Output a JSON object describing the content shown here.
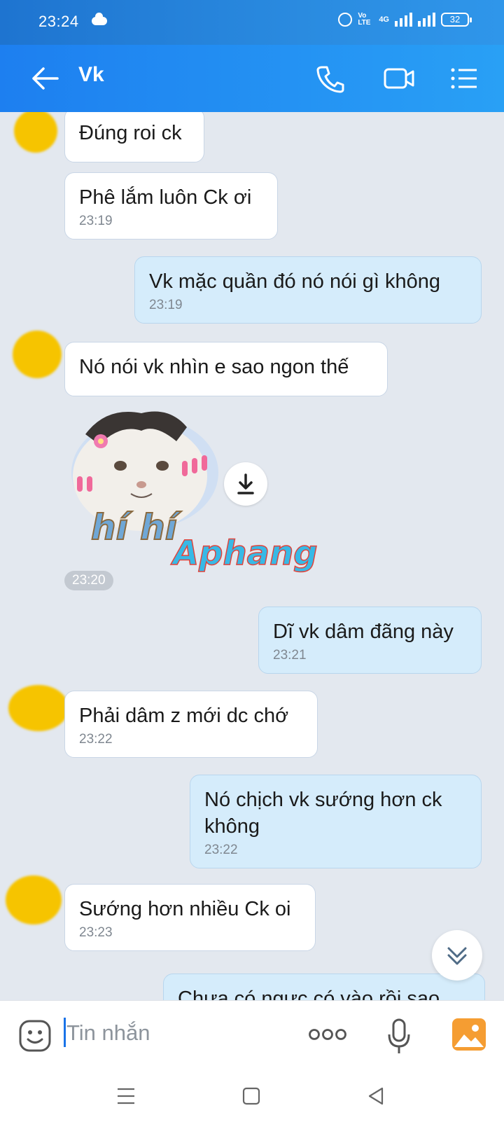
{
  "status_bar": {
    "time": "23:24",
    "network_label": "4G",
    "volte_label": "Vo LTE",
    "battery": "32"
  },
  "header": {
    "back_label": "back",
    "contact_name": "Vk"
  },
  "messages": [
    {
      "dir": "in",
      "text": "Đúng roi ck",
      "time": ""
    },
    {
      "dir": "in",
      "text": "Phê lắm luôn Ck ơi",
      "time": "23:19"
    },
    {
      "dir": "out",
      "text": "Vk mặc quần đó nó nói gì không",
      "time": "23:19"
    },
    {
      "dir": "in",
      "text": "Nó nói vk nhìn e sao ngon thế",
      "time": ""
    },
    {
      "dir": "in",
      "type": "sticker",
      "sticker_text": "hí hí",
      "watermark": "Aphang",
      "time": "23:20"
    },
    {
      "dir": "out",
      "text": "Dĩ vk dâm đãng này",
      "time": "23:21"
    },
    {
      "dir": "in",
      "text": "Phải dâm z mới dc chớ",
      "time": "23:22"
    },
    {
      "dir": "out",
      "text_line1": "Nó chịch vk sướng hơn ck",
      "text_line2": "không",
      "time": "23:22"
    },
    {
      "dir": "in",
      "text": "Sướng hơn nhiều Ck oi",
      "time": "23:23"
    },
    {
      "dir": "out",
      "text": "Chưa có ngực có vào rồi sao",
      "time": ""
    }
  ],
  "composer": {
    "placeholder": "Tin nhắn"
  },
  "colors": {
    "header_start": "#1d7ff0",
    "header_end": "#29a0f5",
    "bubble_out": "#d5ecfb",
    "bubble_in": "#ffffff",
    "chat_bg": "#e3e8ef"
  }
}
